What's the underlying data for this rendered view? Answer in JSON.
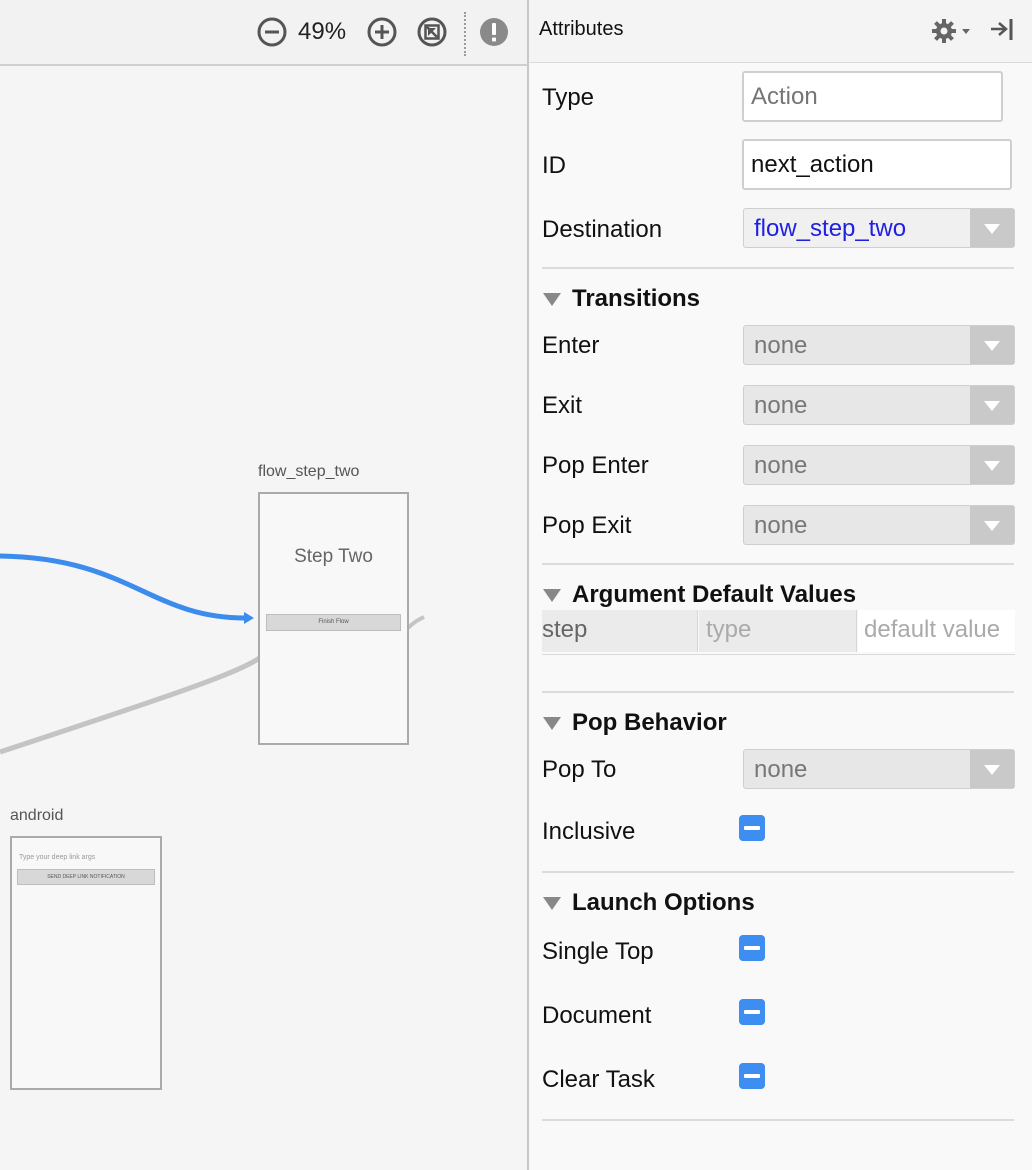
{
  "toolbar": {
    "zoom": "49%",
    "icons": [
      "zoom-out-icon",
      "zoom-in-icon",
      "zoom-to-fit-icon",
      "warning-icon"
    ]
  },
  "canvas": {
    "destinations": [
      {
        "label": "flow_step_two",
        "screen_title": "Step Two",
        "button_text": "Finish Flow"
      },
      {
        "label": "android",
        "hint_text": "Type your deep link args",
        "button_text": "SEND DEEP LINK NOTIFICATION"
      }
    ],
    "action_color": "#3b8ced",
    "connection_color": "#c4c4c4"
  },
  "panel": {
    "title": "Attributes",
    "header_icons": [
      "gear-icon",
      "hide-panel-icon"
    ],
    "type": {
      "label": "Type",
      "placeholder": "Action"
    },
    "id": {
      "label": "ID",
      "value": "next_action"
    },
    "destination": {
      "label": "Destination",
      "value": "flow_step_two"
    },
    "transitions": {
      "title": "Transitions",
      "rows": [
        {
          "label": "Enter",
          "value": "none"
        },
        {
          "label": "Exit",
          "value": "none"
        },
        {
          "label": "Pop Enter",
          "value": "none"
        },
        {
          "label": "Pop Exit",
          "value": "none"
        }
      ]
    },
    "arguments": {
      "title": "Argument Default Values",
      "columns": [
        "step",
        "type",
        "default value"
      ]
    },
    "pop_behavior": {
      "title": "Pop Behavior",
      "pop_to": {
        "label": "Pop To",
        "value": "none"
      },
      "inclusive": {
        "label": "Inclusive",
        "state": "indeterminate"
      }
    },
    "launch_options": {
      "title": "Launch Options",
      "options": [
        {
          "label": "Single Top",
          "state": "indeterminate"
        },
        {
          "label": "Document",
          "state": "indeterminate"
        },
        {
          "label": "Clear Task",
          "state": "indeterminate"
        }
      ]
    },
    "checkbox_color": "#3d8ef0"
  }
}
